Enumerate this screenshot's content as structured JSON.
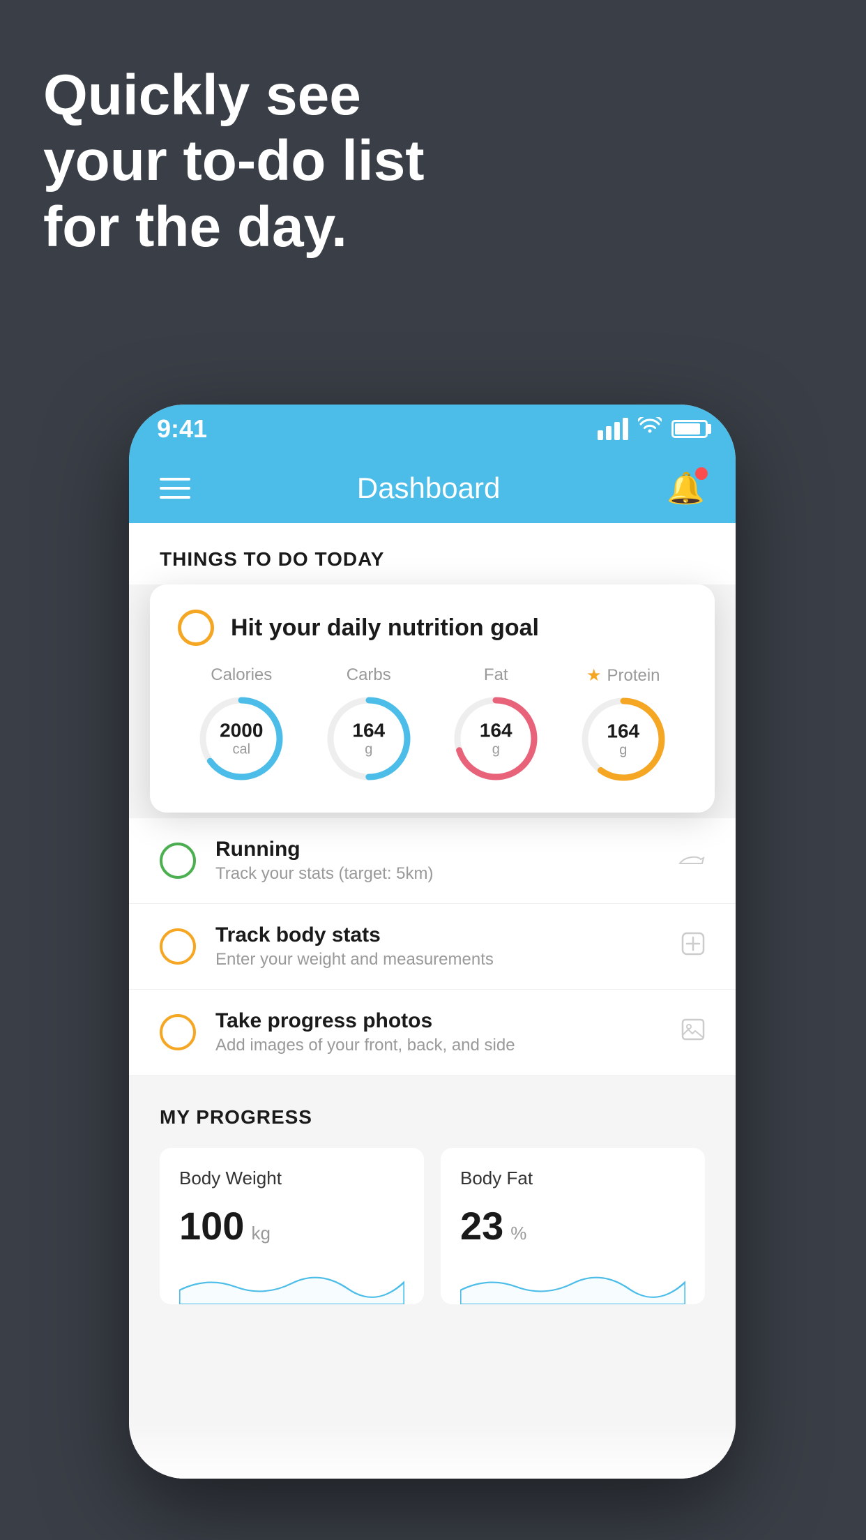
{
  "headline": {
    "line1": "Quickly see",
    "line2": "your to-do list",
    "line3": "for the day."
  },
  "status_bar": {
    "time": "9:41"
  },
  "header": {
    "title": "Dashboard"
  },
  "things_section": {
    "title": "THINGS TO DO TODAY"
  },
  "nutrition_card": {
    "title": "Hit your daily nutrition goal",
    "columns": [
      {
        "label": "Calories",
        "value": "2000",
        "unit": "cal",
        "color": "#4bbde8",
        "progress": 0.65,
        "starred": false
      },
      {
        "label": "Carbs",
        "value": "164",
        "unit": "g",
        "color": "#4bbde8",
        "progress": 0.5,
        "starred": false
      },
      {
        "label": "Fat",
        "value": "164",
        "unit": "g",
        "color": "#e8627a",
        "progress": 0.7,
        "starred": false
      },
      {
        "label": "Protein",
        "value": "164",
        "unit": "g",
        "color": "#f5a623",
        "progress": 0.6,
        "starred": true
      }
    ]
  },
  "todo_items": [
    {
      "label": "Running",
      "sublabel": "Track your stats (target: 5km)",
      "circle_color": "green",
      "icon": "👟"
    },
    {
      "label": "Track body stats",
      "sublabel": "Enter your weight and measurements",
      "circle_color": "yellow",
      "icon": "⚖"
    },
    {
      "label": "Take progress photos",
      "sublabel": "Add images of your front, back, and side",
      "circle_color": "yellow",
      "icon": "🖼"
    }
  ],
  "progress_section": {
    "title": "MY PROGRESS",
    "cards": [
      {
        "title": "Body Weight",
        "value": "100",
        "unit": "kg"
      },
      {
        "title": "Body Fat",
        "value": "23",
        "unit": "%"
      }
    ]
  }
}
